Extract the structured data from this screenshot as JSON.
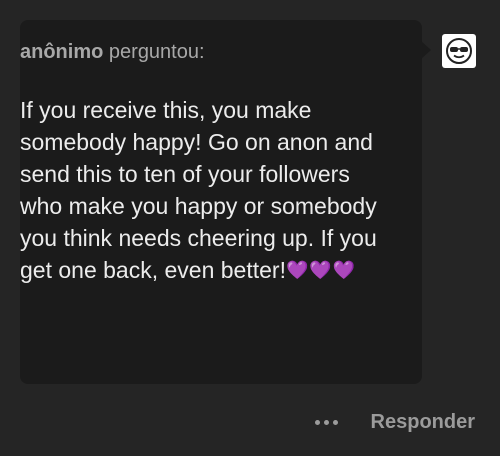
{
  "ask": {
    "asker": "anônimo",
    "verb": "perguntou:",
    "message": "If you receive this, you make somebody happy! Go on anon and send this to ten of your followers who make you happy or somebody you think needs cheering up. If you get one back, even better!",
    "hearts": "💜💜💜"
  },
  "avatar": {
    "icon": "sunglasses-face-icon"
  },
  "actions": {
    "more_icon": "more-dots-icon",
    "reply_label": "Responder"
  },
  "colors": {
    "page_background": "#252525",
    "card_background": "#1b1b1b",
    "header_text": "#a8a8a8",
    "body_text": "#ececec",
    "action_text": "#9b9b9b",
    "heart": "#a63ee0"
  }
}
